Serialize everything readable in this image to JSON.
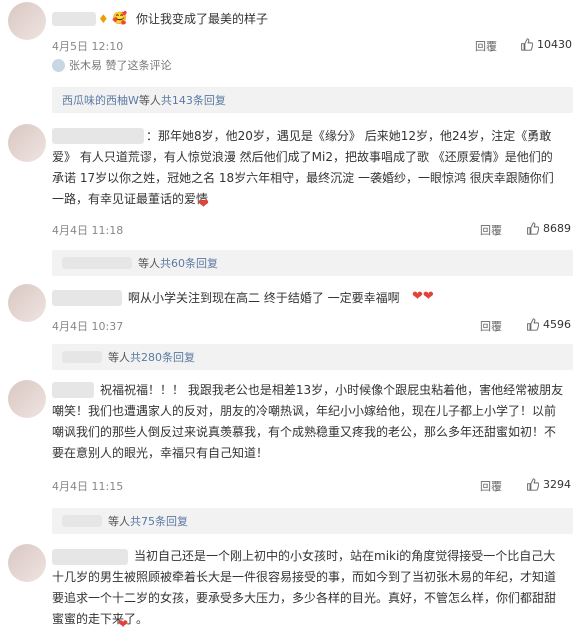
{
  "comments": [
    {
      "text": "你让我变成了最美的样子",
      "date": "4月5日 12:10",
      "reply_label": "回覆",
      "likes": "10430",
      "liked_by": "张木易 赞了这条评论",
      "sub_name": "西瓜味的西柚W",
      "sub_rest": " 等人 ",
      "sub_link": "共143条回复"
    },
    {
      "text": "：那年她8岁，他20岁，遇见是《缘分》 后来她12岁，他24岁，注定《勇敢爱》 有人只道荒谬，有人惊觉浪漫 然后他们成了Mi2，把故事唱成了歌 《还原爱情》是他们的承诺 17岁以你之姓，冠她之名 18岁六年相守，最终沉淀 一袭婚纱，一眼惊鸿 很庆幸跟随你们一路，有幸见证最董话的爱情",
      "date": "4月4日 11:18",
      "reply_label": "回覆",
      "likes": "8689",
      "sub_rest": "等人 ",
      "sub_link": "共60条回复"
    },
    {
      "text": "啊从小学关注到现在高二 终于结婚了 一定要幸福啊",
      "date": "4月4日 10:37",
      "reply_label": "回覆",
      "likes": "4596",
      "sub_rest": "等人 ",
      "sub_link": "共280条回复"
    },
    {
      "text": "祝福祝福！！！ 我跟我老公也是相差13岁，小时候像个跟屁虫粘着他，害他经常被朋友嘲笑！我们也遭遇家人的反对，朋友的冷嘲热讽，年纪小小嫁给他，现在儿子都上小学了！以前嘲讽我们的那些人倒反过来说真羡慕我，有个成熟稳重又疼我的老公，那么多年还甜蜜如初！不要在意别人的眼光，幸福只有自己知道！",
      "date": "4月4日 11:15",
      "reply_label": "回覆",
      "likes": "3294",
      "sub_rest": "等人 ",
      "sub_link": "共75条回复"
    },
    {
      "text": "当初自己还是一个刚上初中的小女孩时，站在miki的角度觉得接受一个比自己大十几岁的男生被照顾被牵着长大是一件很容易接受的事，而如今到了当初张木易的年纪，才知道要追求一个十二岁的女孩，要承受多大压力，多少各样的目光。真好，不管怎么样，你们都甜甜蜜蜜的走下来了。"
    }
  ],
  "colors": {
    "link": "#5a7aa3",
    "heart": "#e0433a",
    "sub_bg": "#f2f2f2"
  }
}
